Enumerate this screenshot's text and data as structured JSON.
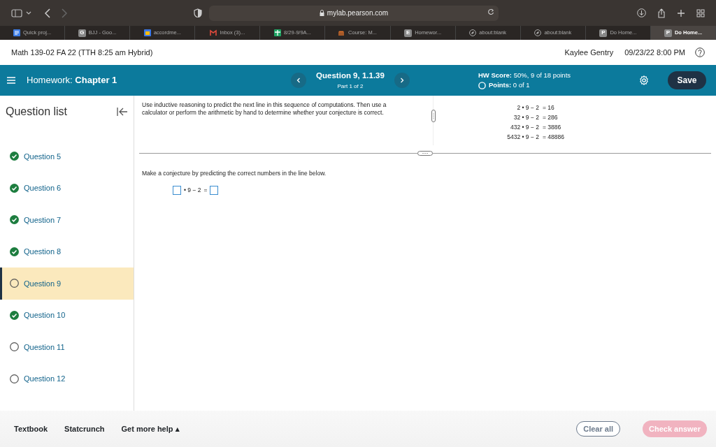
{
  "browser": {
    "url": "mylab.pearson.com",
    "tabs": [
      {
        "kind": "doc",
        "label": "Quick proj...",
        "selected": false
      },
      {
        "kind": "letter",
        "letter": "G",
        "label": "BJJ - Goo...",
        "selected": false
      },
      {
        "kind": "calendar",
        "label": "accordme...",
        "selected": false
      },
      {
        "kind": "mail",
        "label": "Inbox (3)...",
        "selected": false
      },
      {
        "kind": "sheet",
        "label": "8/29-9/9A...",
        "selected": false
      },
      {
        "kind": "course",
        "label": "Course: M...",
        "selected": false
      },
      {
        "kind": "letter",
        "letter": "E",
        "label": "Homewor...",
        "selected": false
      },
      {
        "kind": "compass",
        "label": "about:blank",
        "selected": false
      },
      {
        "kind": "compass",
        "label": "about:blank",
        "selected": false
      },
      {
        "kind": "letter",
        "letter": "P",
        "label": "Do Home...",
        "selected": false
      },
      {
        "kind": "letter",
        "letter": "P",
        "label": "Do Home...",
        "selected": true
      }
    ]
  },
  "course": {
    "title": "Math 139-02 FA 22 (TTH 8:25 am Hybrid)",
    "user": "Kaylee Gentry",
    "due": "09/23/22 8:00 PM"
  },
  "toolbar": {
    "label": "Homework:",
    "assignment": "Chapter 1",
    "question": "Question 9, 1.1.39",
    "part": "Part 1 of 2",
    "score_label": "HW Score:",
    "score": "50%, 9 of 18 points",
    "points_label": "Points:",
    "points": "0 of 1",
    "save": "Save"
  },
  "sidebar": {
    "title": "Question list",
    "items": [
      {
        "label": "Question 5",
        "completed": true,
        "selected": false
      },
      {
        "label": "Question 6",
        "completed": true,
        "selected": false
      },
      {
        "label": "Question 7",
        "completed": true,
        "selected": false
      },
      {
        "label": "Question 8",
        "completed": true,
        "selected": false
      },
      {
        "label": "Question 9",
        "completed": false,
        "selected": true
      },
      {
        "label": "Question 10",
        "completed": true,
        "selected": false
      },
      {
        "label": "Question 11",
        "completed": false,
        "selected": false
      },
      {
        "label": "Question 12",
        "completed": false,
        "selected": false
      }
    ]
  },
  "question": {
    "instructions": "Use inductive reasoning to predict the next line in this sequence of computations. Then use a calculator or perform the arithmetic by hand to determine whether your conjecture is correct.",
    "equations": [
      {
        "lhs": "2 • 9 − 2",
        "rhs": "= 16"
      },
      {
        "lhs": "32 • 9 − 2",
        "rhs": "= 286"
      },
      {
        "lhs": "432 • 9 − 2",
        "rhs": "= 3886"
      },
      {
        "lhs": "5432 • 9 − 2",
        "rhs": "= 48886"
      }
    ],
    "prompt": "Make a conjecture by predicting the correct numbers in the line below.",
    "answer_middle": "• 9 − 2",
    "answer_equals": "="
  },
  "footer": {
    "links": [
      "Textbook",
      "Statcrunch",
      "Get more help ▴"
    ],
    "clear": "Clear all",
    "check": "Check answer",
    "check_disabled": true
  }
}
